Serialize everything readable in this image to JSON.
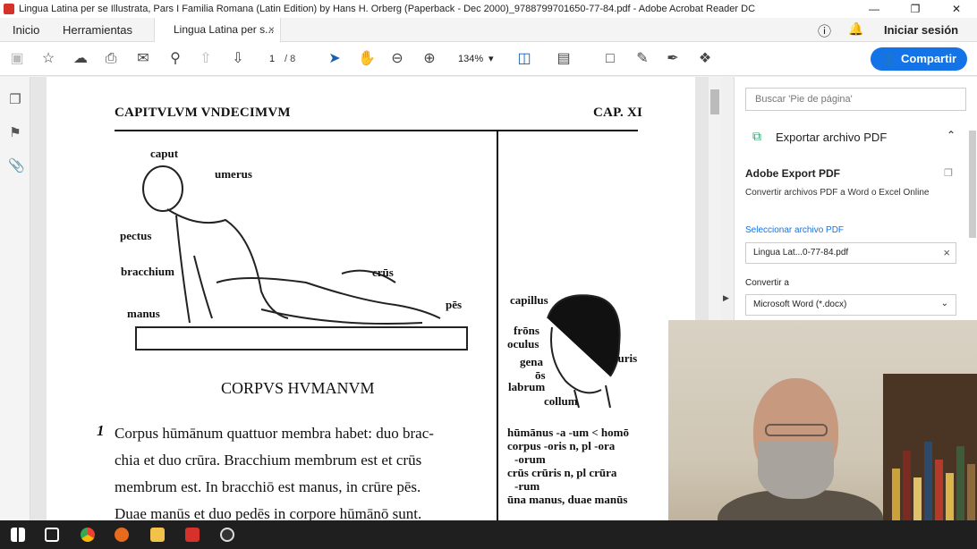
{
  "window": {
    "title": "Lingua Latina per se Illustrata, Pars I Familia Romana (Latin Edition) by Hans H. Orberg (Paperback - Dec 2000)_9788799701650-77-84.pdf - Adobe Acrobat Reader DC",
    "minimize": "—",
    "maximize": "❐",
    "close": "✕"
  },
  "menu": {
    "home": "Inicio",
    "tools": "Herramientas",
    "doc_tab": "Lingua Latina per s...",
    "doc_tab_close": "×",
    "signin": "Iniciar sesión"
  },
  "toolbar": {
    "page_current": "1",
    "page_total": "/ 8",
    "zoom": "134%",
    "zoom_caret": "▾",
    "share": "Compartir"
  },
  "document": {
    "header_left": "CAPITVLVM VNDECIMVM",
    "header_right": "CAP. XI",
    "labels": {
      "caput": "caput",
      "umerus": "umerus",
      "pectus": "pectus",
      "bracchium": "bracchium",
      "crus": "crūs",
      "manus": "manus",
      "pes": "pēs",
      "capillus": "capillus",
      "frons": "frōns",
      "oculus": "oculus",
      "gena": "gena",
      "os": "ōs",
      "labrum": "labrum",
      "auris": "auris",
      "collum": "collum"
    },
    "caption": "CORPVS HVMANVM",
    "line_number": "1",
    "lines": [
      "Corpus hūmānum quattuor membra habet: duo brac-",
      "chia et duo crūra. Bracchium membrum est et crūs",
      "membrum est. In bracchiō est manus, in crūre pēs.",
      "Duae manūs et duo pedēs in corpore hūmānō sunt."
    ],
    "margin_notes": [
      "hūmānus -a -um < homō",
      "corpus -oris n, pl -ora",
      "-orum",
      "crūs crūris n, pl crūra",
      "-rum",
      "ūna manus, duae manūs"
    ]
  },
  "right_pane": {
    "search_placeholder": "Buscar 'Pie de página'",
    "export_header": "Exportar archivo PDF",
    "export_title": "Adobe Export PDF",
    "export_desc": "Convertir archivos PDF a Word o Excel Online",
    "select_file_label": "Seleccionar archivo PDF",
    "file_name": "Lingua Lat...0-77-84.pdf",
    "convert_to_label": "Convertir a",
    "convert_to_value": "Microsoft Word (*.docx)"
  },
  "colors": {
    "accent": "#1473e6",
    "acrobat_red": "#d6312a",
    "export_green": "#2a9d6b"
  }
}
